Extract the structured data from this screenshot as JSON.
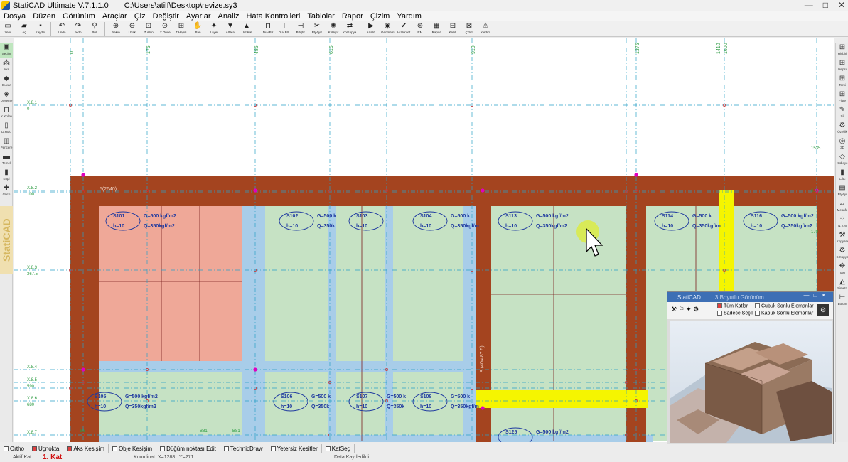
{
  "title": {
    "app": "StatiCAD Ultimate V.7.1.1.0",
    "path": "C:\\Users\\atilf\\Desktop\\revize.sy3",
    "buttons": [
      "—",
      "□",
      "✕"
    ]
  },
  "menu": [
    "Dosya",
    "Düzen",
    "Görünüm",
    "Araçlar",
    "Çiz",
    "Değiştir",
    "Ayarlar",
    "Analiz",
    "Hata Kontrolleri",
    "Tablolar",
    "Rapor",
    "Çizim",
    "Yardım"
  ],
  "toolbar": [
    {
      "label": "Yeni",
      "icon": "new-file-icon",
      "glyph": "▭"
    },
    {
      "label": "Aç",
      "icon": "open-folder-icon",
      "glyph": "▰"
    },
    {
      "label": "Kaydet",
      "icon": "save-icon",
      "glyph": "▪"
    },
    {
      "sep": true
    },
    {
      "label": "Undo",
      "icon": "undo-icon",
      "glyph": "↶"
    },
    {
      "label": "redo",
      "icon": "redo-icon",
      "glyph": "↷"
    },
    {
      "label": "Bul",
      "icon": "find-icon",
      "glyph": "⚲"
    },
    {
      "sep": true
    },
    {
      "label": "Yakın",
      "icon": "zoom-in-icon",
      "glyph": "⊕"
    },
    {
      "label": "Uzak",
      "icon": "zoom-out-icon",
      "glyph": "⊖"
    },
    {
      "label": "Z.Alan",
      "icon": "zoom-area-icon",
      "glyph": "⊡"
    },
    {
      "label": "Z.Önce",
      "icon": "zoom-previous-icon",
      "glyph": "⊙"
    },
    {
      "label": "Z.Hepsi",
      "icon": "zoom-all-icon",
      "glyph": "⊞"
    },
    {
      "label": "Pan",
      "icon": "pan-hand-icon",
      "glyph": "✋"
    },
    {
      "label": "Layer",
      "icon": "layer-bulb-icon",
      "glyph": "✦"
    },
    {
      "label": "Alt Kat",
      "icon": "floor-down-icon",
      "glyph": "▼"
    },
    {
      "label": "Üst Kat",
      "icon": "floor-up-icon",
      "glyph": "▲"
    },
    {
      "sep": true
    },
    {
      "label": "Duv.Bir",
      "icon": "wall-join-icon",
      "glyph": "⊓"
    },
    {
      "label": "Duv.Böl",
      "icon": "wall-split-icon",
      "glyph": "⊤"
    },
    {
      "label": "Bitiştir",
      "icon": "attach-icon",
      "glyph": "⊣"
    },
    {
      "label": "PlyAyır",
      "icon": "split-icon",
      "glyph": "✂"
    },
    {
      "label": "KolAyır",
      "icon": "column-split-icon",
      "glyph": "✺"
    },
    {
      "label": "KolKopya",
      "icon": "column-copy-icon",
      "glyph": "⇄"
    },
    {
      "sep": true
    },
    {
      "label": "Analiz",
      "icon": "analysis-icon",
      "glyph": "▶"
    },
    {
      "label": "Geometri",
      "icon": "geometry-icon",
      "glyph": "◉"
    },
    {
      "label": "HızlıKont",
      "icon": "quick-check-icon",
      "glyph": "✔"
    },
    {
      "label": "RM",
      "icon": "rm-icon",
      "glyph": "⊛"
    },
    {
      "label": "Rapor",
      "icon": "report-icon",
      "glyph": "▦"
    },
    {
      "label": "Kesit",
      "icon": "section-icon",
      "glyph": "⊟"
    },
    {
      "label": "Çizim",
      "icon": "drawing-icon",
      "glyph": "⊠"
    },
    {
      "label": "Yardım",
      "icon": "help-icon",
      "glyph": "⚠"
    }
  ],
  "left_tools": [
    {
      "label": "Seçim",
      "icon": "select-icon",
      "glyph": "▣",
      "active": true
    },
    {
      "label": "Aks",
      "icon": "axis-icon",
      "glyph": "⁂"
    },
    {
      "label": "Duvar",
      "icon": "wall-icon",
      "glyph": "◆"
    },
    {
      "label": "Döşeme",
      "icon": "slab-icon",
      "glyph": "◈"
    },
    {
      "label": "K.Kolon",
      "icon": "column-icon",
      "glyph": "⊓"
    },
    {
      "label": "D.Holo",
      "icon": "hollow-icon",
      "glyph": "▯"
    },
    {
      "label": "Pencere",
      "icon": "window-icon",
      "glyph": "▥"
    },
    {
      "label": "Temel",
      "icon": "foundation-icon",
      "glyph": "▬"
    },
    {
      "label": "Kopi",
      "icon": "copy-icon",
      "glyph": "▮"
    },
    {
      "label": "Gücü",
      "icon": "power-icon",
      "glyph": "✚"
    }
  ],
  "brand": "StatiCAD",
  "right_tools": [
    {
      "label": "Hiçbiri",
      "icon": "none-icon",
      "glyph": "⊞"
    },
    {
      "label": "Hepsi",
      "icon": "all-icon",
      "glyph": "⊞"
    },
    {
      "label": "Tersi",
      "icon": "invert-icon",
      "glyph": "⊞"
    },
    {
      "label": "Filtre",
      "icon": "filter-icon",
      "glyph": "⊞"
    },
    {
      "label": "Sil",
      "icon": "delete-icon",
      "glyph": "✎"
    },
    {
      "label": "Özellik",
      "icon": "properties-icon",
      "glyph": "⚙"
    },
    {
      "label": "3D",
      "icon": "3d-icon",
      "glyph": "◎"
    },
    {
      "label": "Küboye",
      "icon": "cube-icon",
      "glyph": "◇"
    },
    {
      "label": "Ciltc",
      "icon": "measure-icon",
      "glyph": "▮"
    },
    {
      "label": "PlyAyı",
      "icon": "ply-icon",
      "glyph": "▤"
    },
    {
      "label": "Mesafe",
      "icon": "distance-icon",
      "glyph": "↔"
    },
    {
      "label": "N.V.M",
      "icon": "nvm-icon",
      "glyph": "⁘"
    },
    {
      "label": "Kopyala",
      "icon": "copy2-icon",
      "glyph": "⚒"
    },
    {
      "label": "S.Kopya",
      "icon": "special-copy-icon",
      "glyph": "⚙"
    },
    {
      "label": "Taşı",
      "icon": "move-icon",
      "glyph": "✥"
    },
    {
      "label": "Simetri",
      "icon": "mirror-icon",
      "glyph": "◭"
    },
    {
      "label": "Bölüm",
      "icon": "divide-icon",
      "glyph": "⊢"
    }
  ],
  "drawing": {
    "axis_top_labels": [
      "0",
      "175",
      "485",
      "615",
      "910",
      "1375",
      "1410",
      "1600"
    ],
    "axis_left_labels": [
      {
        "name": "X.8.1",
        "value": "0"
      },
      {
        "name": "X.8.2",
        "value": "100"
      },
      {
        "name": "X.8.3",
        "value": "367.5"
      },
      {
        "name": "X.8.4",
        "value": ""
      },
      {
        "name": "X.8.5",
        "value": "590"
      },
      {
        "name": "X.8.6",
        "value": "680"
      },
      {
        "name": "X.8.7",
        "value": ""
      }
    ],
    "beam_label": "5(2640)",
    "vertical_beam_label": "8 (40/487.5)",
    "slabs": [
      {
        "id": "S101",
        "g": "G=500 kgf/m2",
        "q": "Q=350kgf/m2",
        "h": "h=10"
      },
      {
        "id": "S102",
        "g": "G=500 k",
        "q": "Q=350k",
        "h": "h=10"
      },
      {
        "id": "S103",
        "g": "",
        "q": "",
        "h": "h=10"
      },
      {
        "id": "S104",
        "g": "G=500 k",
        "q": "Q=350kgf/m",
        "h": "h=10"
      },
      {
        "id": "S113",
        "g": "G=500 kgf/m2",
        "q": "Q=350kgf/m2",
        "h": "h=10"
      },
      {
        "id": "S114",
        "g": "G=500 k",
        "q": "Q=350kgf/m",
        "h": "h=10"
      },
      {
        "id": "S116",
        "g": "G=500 kgf/m2",
        "q": "Q=350kgf/m2",
        "h": "h=10"
      },
      {
        "id": "S105",
        "g": "G=500 kgf/m2",
        "q": "Q=350kgf/m2",
        "h": "h=10"
      },
      {
        "id": "S106",
        "g": "G=500 k",
        "q": "Q=350k",
        "h": "h=10"
      },
      {
        "id": "S107",
        "g": "G=500 k",
        "q": "Q=350k",
        "h": "h=10"
      },
      {
        "id": "S108",
        "g": "G=500 k",
        "q": "Q=350kgf/m",
        "h": "h=10"
      },
      {
        "id": "S125",
        "g": "G=500 kgf/m2",
        "q": "",
        "h": ""
      }
    ],
    "small_labels": [
      "1535",
      "170",
      "6.0"
    ],
    "bottom_labels": [
      "B5",
      "B81",
      "B81"
    ]
  },
  "colors": {
    "beam": "#a4441f",
    "slab": "#c6e2c4",
    "slab_selected": "#efa898",
    "strip": "#a8cde9",
    "highlight": "#f5f500",
    "slab_outline": "#1f3aa0",
    "axis": "#2aa0c6"
  },
  "panel3d": {
    "title": "StatiCAD",
    "subtitle": "3 Boyutlu Görünüm",
    "tum_katlar": "Tüm Katlar",
    "sadece_secili": "Sadece Seçili",
    "cubuk": "Çubuk Sonlu Elemanlar",
    "kabuk": "Kabuk Sonlu Elemanlar"
  },
  "status": [
    {
      "label": "Ortho",
      "on": false
    },
    {
      "label": "Uçnokta",
      "on": true
    },
    {
      "label": "Aks Kesişim",
      "on": true
    },
    {
      "label": "Obje Kesişim",
      "on": false
    },
    {
      "label": "Düğüm noktası Edit",
      "on": false
    },
    {
      "label": "TechnicDraw",
      "on": false
    },
    {
      "label": "Yetersiz Kesitler",
      "on": false
    },
    {
      "label": "KatSeç",
      "on": false
    }
  ],
  "info": {
    "aktif_kat_label": "Aktif Kat",
    "floor": "1. Kat",
    "koordinat_label": "Koordinat",
    "x": "X=1288",
    "y": "Y=271",
    "message": "Data Kaydedildi"
  }
}
